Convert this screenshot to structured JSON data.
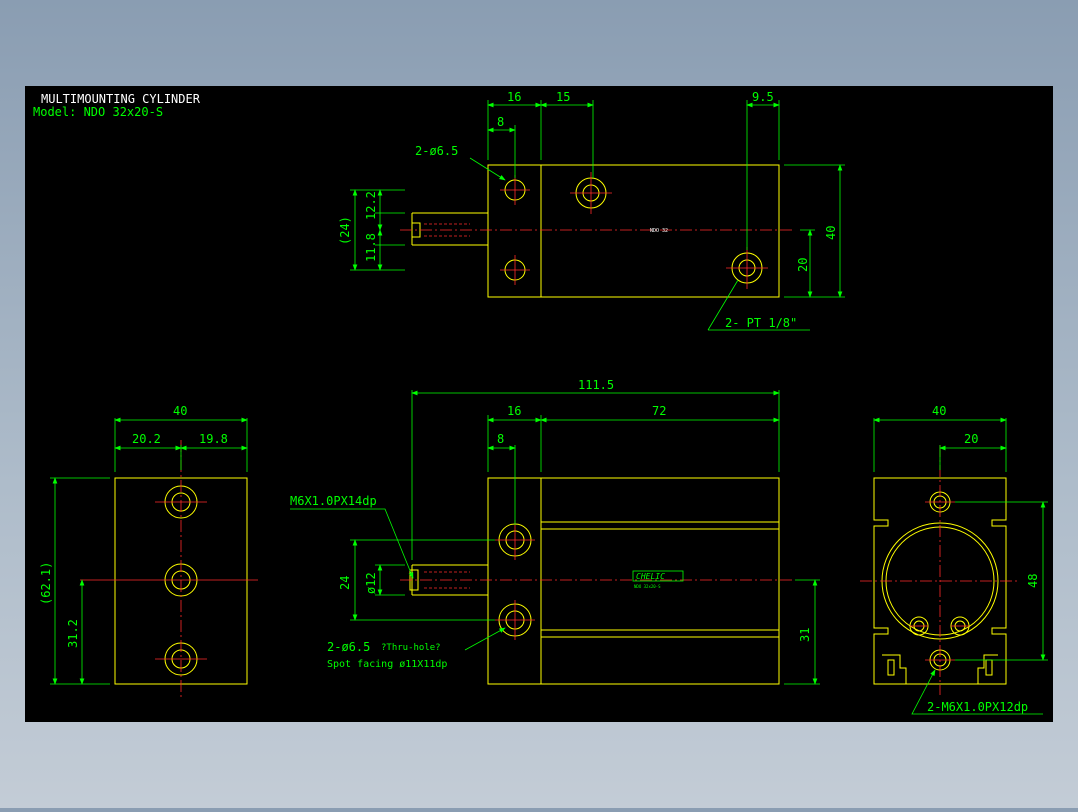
{
  "title_block": {
    "title": "MULTIMOUNTING CYLINDER",
    "model": "Model:  NDO 32x20-S"
  },
  "top_view": {
    "dim_16": "16",
    "dim_15": "15",
    "dim_8": "8",
    "dim_9_5": "9.5",
    "dim_12_2": "12.2",
    "dim_11_8": "11.8",
    "dim_24_ref": "(24)",
    "dim_40": "40",
    "dim_20": "20",
    "callout_holes": "2-ø6.5",
    "callout_ports": "2- PT 1/8\"",
    "body_label": "NDO 32"
  },
  "front_view": {
    "dim_111_5": "111.5",
    "dim_16": "16",
    "dim_72": "72",
    "dim_8": "8",
    "dim_24": "24",
    "dim_phi12": "ø12",
    "dim_31": "31",
    "callout_thread": "M6X1.0PX14dp",
    "callout_holes": "2-ø6.5",
    "callout_holes_note": "?Thru-hole?",
    "callout_spot": "Spot facing   ø11X11dp",
    "logo": "CHELIC",
    "logo_sub": "NDO 32x20-S"
  },
  "left_view": {
    "dim_40": "40",
    "dim_20_2": "20.2",
    "dim_19_8": "19.8",
    "dim_62_1": "(62.1)",
    "dim_31_2": "31.2"
  },
  "right_view": {
    "dim_40": "40",
    "dim_20": "20",
    "dim_48": "48",
    "callout_thread": "2-M6X1.0PX12dp"
  },
  "colors": {
    "background": "#000000",
    "outline": "#ffff00",
    "dimension": "#00ff00",
    "centerline": "#ff2a2a",
    "text": "#ffffff"
  }
}
